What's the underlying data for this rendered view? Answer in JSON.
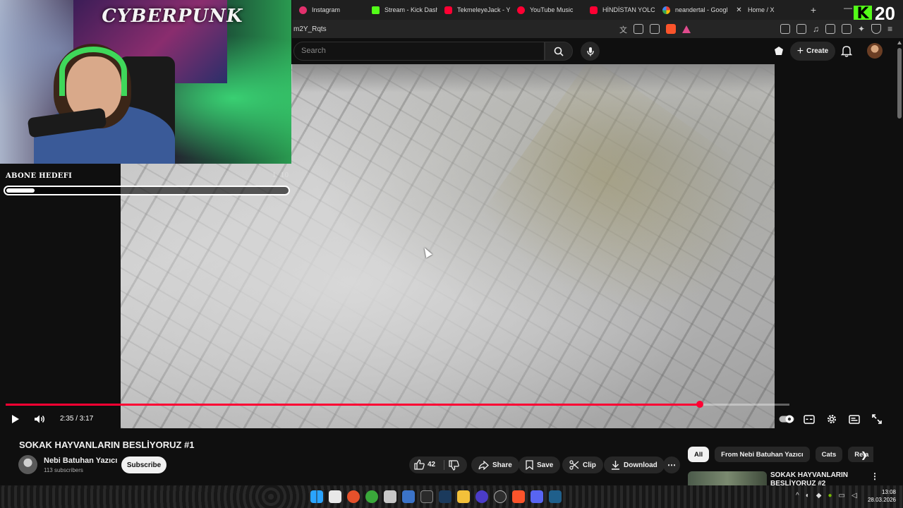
{
  "browser": {
    "tabs": [
      {
        "label": "Instagram",
        "color": "#e1306c"
      },
      {
        "label": "Stream - Kick Dashb",
        "color": "#53fc18"
      },
      {
        "label": "TekmeleyeJack - Yo",
        "color": "#ff0033"
      },
      {
        "label": "YouTube Music",
        "color": "#ff0033"
      },
      {
        "label": "HİNDİSTAN YOLCU",
        "color": "#ff0033"
      },
      {
        "label": "neandertal - Googl",
        "color": "#4285f4"
      },
      {
        "label": "Home / X",
        "color": "#000000"
      }
    ],
    "url": "m2Y_Rqts"
  },
  "kick_badge": {
    "letter": "K",
    "number": "20"
  },
  "youtube": {
    "search_placeholder": "Search",
    "create_label": "Create"
  },
  "overlay": {
    "poster_text": "CYBERPUNK",
    "goal_label": "ABONE HEDEFI",
    "goal_current": "1",
    "goal_target": "10",
    "goal_fraction": 0.1
  },
  "player": {
    "time": "2:35 / 3:17",
    "progress_fraction": 0.886
  },
  "video": {
    "title": "SOKAK HAYVANLARIN BESLİYORUZ #1",
    "channel_name": "Nebi Batuhan Yazıcı",
    "subscribers": "113 subscribers",
    "subscribe_label": "Subscribe",
    "like_count": "42",
    "share_label": "Share",
    "save_label": "Save",
    "clip_label": "Clip",
    "download_label": "Download"
  },
  "chips": [
    "All",
    "From Nebi Batuhan Yazıcı",
    "Cats",
    "Rela"
  ],
  "recommendation": {
    "title": "SOKAK HAYVANLARIN BESLİYORUZ #2"
  },
  "taskbar": {
    "time": "13:08",
    "date": "28.03.2026"
  },
  "colors": {
    "accent": "#ff0033",
    "kick": "#53fc18"
  }
}
